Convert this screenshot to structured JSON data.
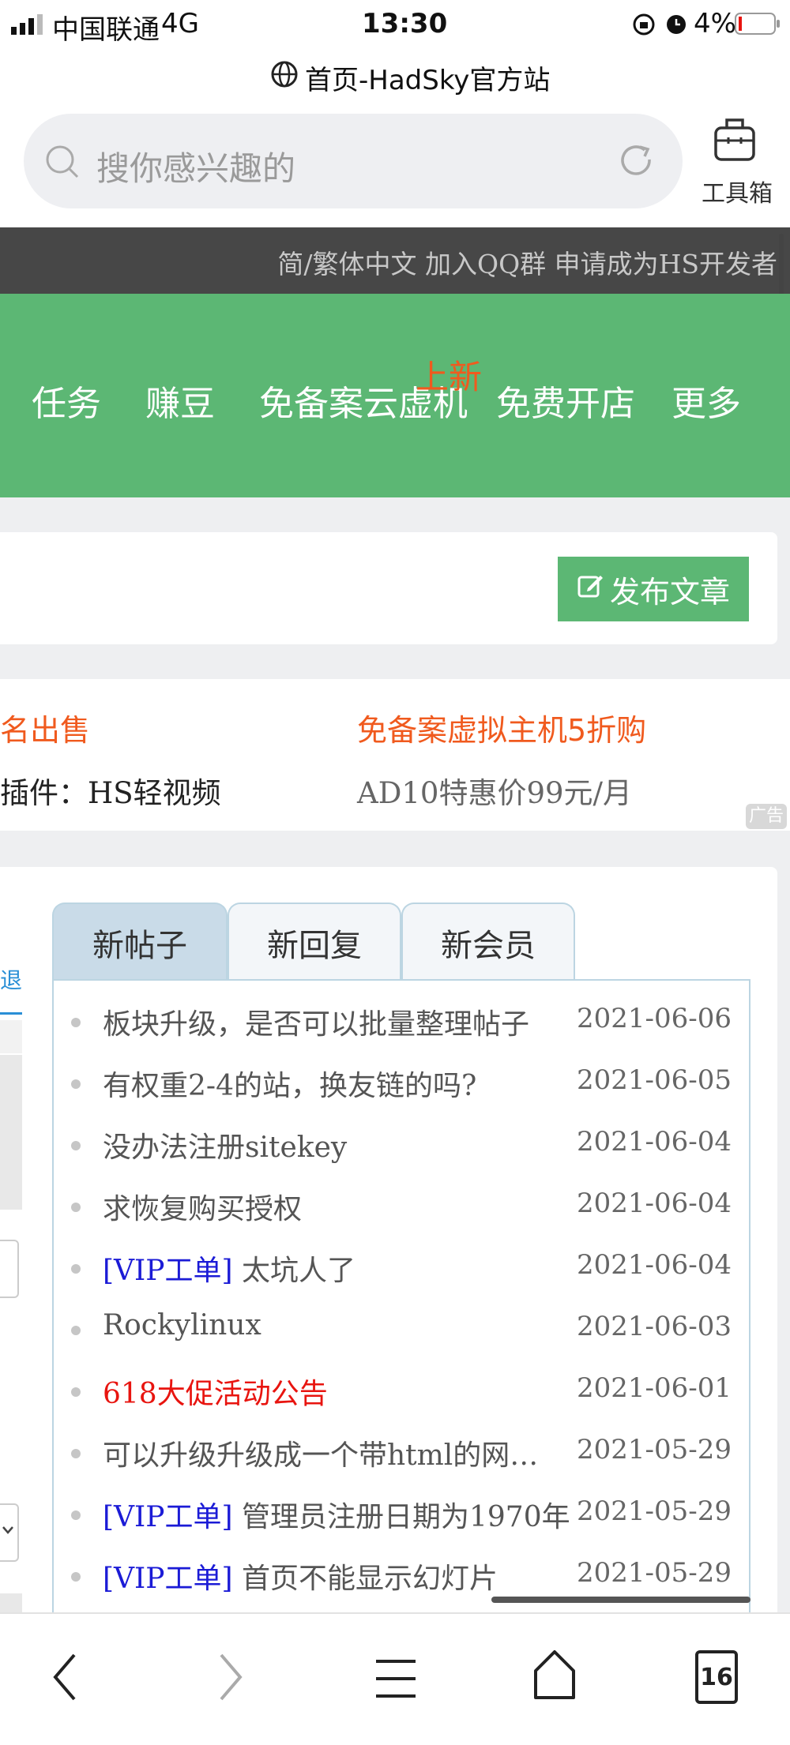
{
  "status_bar": {
    "carrier": "中国联通",
    "network": "4G",
    "time": "13:30",
    "battery": "4%"
  },
  "browser": {
    "page_title": "首页-HadSky官方站",
    "search_placeholder": "搜你感兴趣的",
    "toolbox_label": "工具箱",
    "tabs_count": "16"
  },
  "top_links": "简/繁体中文  加入QQ群  申请成为HS开发者",
  "nav": {
    "items": [
      "任务",
      "赚豆",
      "免备案云虚机",
      "免费开店",
      "更多"
    ],
    "badge": "上新"
  },
  "post_button": "发布文章",
  "ads": {
    "left_title": "名出售",
    "left_desc": "插件：HS轻视频",
    "right_title": "免备案虚拟主机5折购",
    "right_desc": "AD10特惠价99元/月",
    "ad_label": "广告"
  },
  "side_fragment": "退",
  "tabs": [
    "新帖子",
    "新回复",
    "新会员"
  ],
  "posts": [
    {
      "tag": "",
      "title": "板块升级，是否可以批量整理帖子",
      "date": "2021-06-06",
      "red": false
    },
    {
      "tag": "",
      "title": "有权重2-4的站，换友链的吗?",
      "date": "2021-06-05",
      "red": false
    },
    {
      "tag": "",
      "title": "没办法注册sitekey",
      "date": "2021-06-04",
      "red": false
    },
    {
      "tag": "",
      "title": "求恢复购买授权",
      "date": "2021-06-04",
      "red": false
    },
    {
      "tag": "[VIP工单]",
      "title": " 太坑人了",
      "date": "2021-06-04",
      "red": false
    },
    {
      "tag": "",
      "title": "Rockylinux",
      "date": "2021-06-03",
      "red": false
    },
    {
      "tag": "",
      "title": "618大促活动公告",
      "date": "2021-06-01",
      "red": true
    },
    {
      "tag": "",
      "title": "可以升级升级成一个带html的网…",
      "date": "2021-05-29",
      "red": false
    },
    {
      "tag": "[VIP工单]",
      "title": " 管理员注册日期为1970年",
      "date": "2021-05-29",
      "red": false
    },
    {
      "tag": "[VIP工单]",
      "title": " 首页不能显示幻灯片",
      "date": "2021-05-29",
      "red": false
    }
  ],
  "colors": {
    "green": "#5cb774",
    "orange": "#f05a1e",
    "red": "#e8140f",
    "vip_blue": "#1b1bd6"
  }
}
